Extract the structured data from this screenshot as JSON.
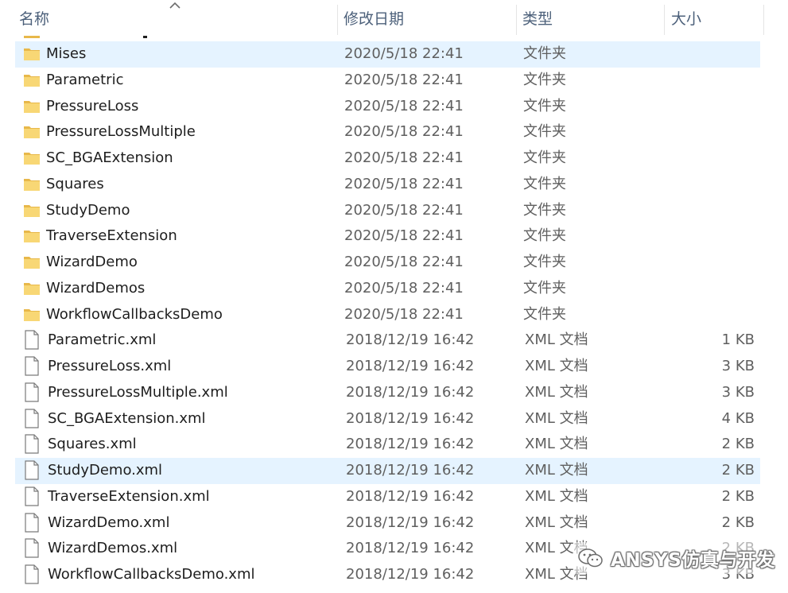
{
  "columns": {
    "name": "名称",
    "date": "修改日期",
    "type": "类型",
    "size": "大小"
  },
  "sort": {
    "column": "name",
    "direction": "ascending",
    "icon": "sort-up-chevron-icon"
  },
  "colors": {
    "folder": "#f8d775",
    "folder_dark": "#e8b84a",
    "highlight": "#e5f3ff",
    "header_text": "#4c607a"
  },
  "rows": [
    {
      "kind": "folder",
      "name": "Mises",
      "date": "2020/5/18 22:41",
      "type": "文件夹",
      "size": "",
      "highlighted": true
    },
    {
      "kind": "folder",
      "name": "Parametric",
      "date": "2020/5/18 22:41",
      "type": "文件夹",
      "size": ""
    },
    {
      "kind": "folder",
      "name": "PressureLoss",
      "date": "2020/5/18 22:41",
      "type": "文件夹",
      "size": ""
    },
    {
      "kind": "folder",
      "name": "PressureLossMultiple",
      "date": "2020/5/18 22:41",
      "type": "文件夹",
      "size": ""
    },
    {
      "kind": "folder",
      "name": "SC_BGAExtension",
      "date": "2020/5/18 22:41",
      "type": "文件夹",
      "size": ""
    },
    {
      "kind": "folder",
      "name": "Squares",
      "date": "2020/5/18 22:41",
      "type": "文件夹",
      "size": ""
    },
    {
      "kind": "folder",
      "name": "StudyDemo",
      "date": "2020/5/18 22:41",
      "type": "文件夹",
      "size": ""
    },
    {
      "kind": "folder",
      "name": "TraverseExtension",
      "date": "2020/5/18 22:41",
      "type": "文件夹",
      "size": ""
    },
    {
      "kind": "folder",
      "name": "WizardDemo",
      "date": "2020/5/18 22:41",
      "type": "文件夹",
      "size": ""
    },
    {
      "kind": "folder",
      "name": "WizardDemos",
      "date": "2020/5/18 22:41",
      "type": "文件夹",
      "size": ""
    },
    {
      "kind": "folder",
      "name": "WorkflowCallbacksDemo",
      "date": "2020/5/18 22:41",
      "type": "文件夹",
      "size": ""
    },
    {
      "kind": "file",
      "name": "Parametric.xml",
      "date": "2018/12/19 16:42",
      "type": "XML 文档",
      "size": "1 KB"
    },
    {
      "kind": "file",
      "name": "PressureLoss.xml",
      "date": "2018/12/19 16:42",
      "type": "XML 文档",
      "size": "3 KB"
    },
    {
      "kind": "file",
      "name": "PressureLossMultiple.xml",
      "date": "2018/12/19 16:42",
      "type": "XML 文档",
      "size": "3 KB"
    },
    {
      "kind": "file",
      "name": "SC_BGAExtension.xml",
      "date": "2018/12/19 16:42",
      "type": "XML 文档",
      "size": "4 KB"
    },
    {
      "kind": "file",
      "name": "Squares.xml",
      "date": "2018/12/19 16:42",
      "type": "XML 文档",
      "size": "2 KB"
    },
    {
      "kind": "file",
      "name": "StudyDemo.xml",
      "date": "2018/12/19 16:42",
      "type": "XML 文档",
      "size": "2 KB",
      "highlighted": true
    },
    {
      "kind": "file",
      "name": "TraverseExtension.xml",
      "date": "2018/12/19 16:42",
      "type": "XML 文档",
      "size": "2 KB"
    },
    {
      "kind": "file",
      "name": "WizardDemo.xml",
      "date": "2018/12/19 16:42",
      "type": "XML 文档",
      "size": "2 KB"
    },
    {
      "kind": "file",
      "name": "WizardDemos.xml",
      "date": "2018/12/19 16:42",
      "type": "XML 文档",
      "size": "2 KB"
    },
    {
      "kind": "file",
      "name": "WorkflowCallbacksDemo.xml",
      "date": "2018/12/19 16:42",
      "type": "XML 文档",
      "size": "3 KB"
    }
  ],
  "watermark": {
    "text": "ANSYS仿真与开发",
    "icon": "wechat-official-account-icon"
  }
}
